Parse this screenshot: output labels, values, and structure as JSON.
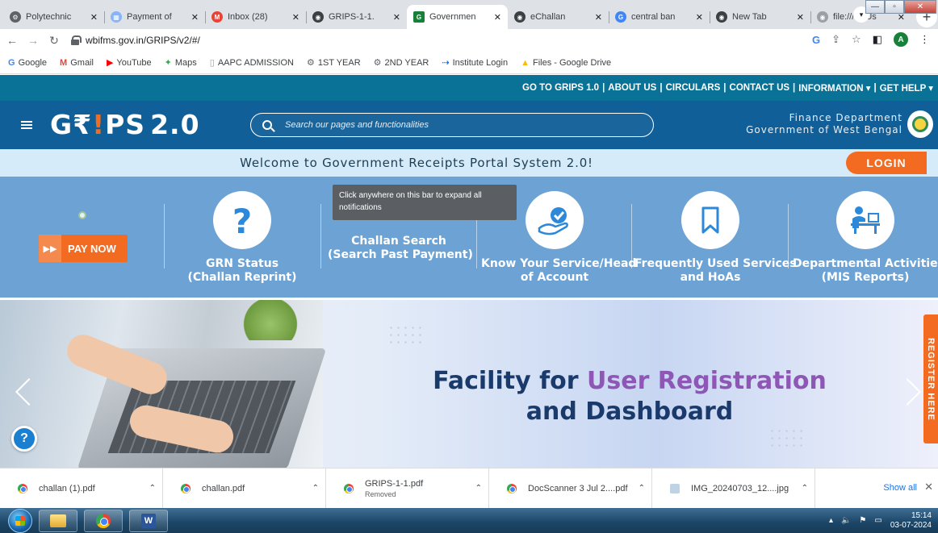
{
  "browser": {
    "tabs": [
      {
        "title": "Polytechnic",
        "favicon_color": "#5f6368",
        "active": false
      },
      {
        "title": "Payment of",
        "favicon_color": "#8ab4f8",
        "active": false
      },
      {
        "title": "Inbox (28)",
        "favicon_color": "#ea4335",
        "active": false
      },
      {
        "title": "GRIPS-1-1.",
        "favicon_color": "#3c4043",
        "active": false
      },
      {
        "title": "Governmen",
        "favicon_color": "#188038",
        "active": true
      },
      {
        "title": "eChallan",
        "favicon_color": "#3c4043",
        "active": false
      },
      {
        "title": "central ban",
        "favicon_color": "#4285f4",
        "active": false
      },
      {
        "title": "New Tab",
        "favicon_color": "#3c4043",
        "active": false
      },
      {
        "title": "file:///C:/Us",
        "favicon_color": "#9aa0a6",
        "active": false
      }
    ],
    "new_tab_label": "+",
    "url": "wbifms.gov.in/GRIPS/v2/#/",
    "profile_initial": "A",
    "bookmarks": [
      {
        "label": "Google",
        "icon": "G",
        "color": "#4285f4"
      },
      {
        "label": "Gmail",
        "icon": "M",
        "color": "#ea4335"
      },
      {
        "label": "YouTube",
        "icon": "▶",
        "color": "#ff0000"
      },
      {
        "label": "Maps",
        "icon": "✦",
        "color": "#34a853"
      },
      {
        "label": "AAPC ADMISSION",
        "icon": "▯",
        "color": "#9aa0a6"
      },
      {
        "label": "1ST YEAR",
        "icon": "⚙",
        "color": "#5f6368"
      },
      {
        "label": "2ND YEAR",
        "icon": "⚙",
        "color": "#5f6368"
      },
      {
        "label": "Institute Login",
        "icon": "⇢",
        "color": "#1a73e8"
      },
      {
        "label": "Files - Google Drive",
        "icon": "▲",
        "color": "#fbbc05"
      }
    ]
  },
  "site": {
    "topnav": [
      "GO TO GRIPS 1.0",
      "ABOUT US",
      "CIRCULARS",
      "CONTACT US",
      "INFORMATION ▾",
      "GET HELP ▾"
    ],
    "logo_prefix": "G₹",
    "logo_bang": "!",
    "logo_suffix": "PS",
    "logo_version": "2.0",
    "search_placeholder": "Search our pages and functionalities",
    "dept_line1": "Finance Department",
    "dept_line2": "Government of West Bengal",
    "welcome": "Welcome to Government Receipts Portal System 2.0!",
    "login": "LOGIN",
    "pay_now": "PAY NOW",
    "tooltip": "Click anywhere on this bar to expand all notifications",
    "tiles": [
      {
        "line1": "GRN Status",
        "line2": "(Challan Reprint)"
      },
      {
        "line1": "Challan Search",
        "line2": "(Search Past Payment)"
      },
      {
        "line1": "Know Your Service/Head",
        "line2": "of Account"
      },
      {
        "line1": "Frequently Used Services",
        "line2": "and HoAs"
      },
      {
        "line1": "Departmental Activities",
        "line2": "(MIS Reports)"
      }
    ],
    "banner_line1_a": "Facility for ",
    "banner_line1_b": "User Registration",
    "banner_line2": "and Dashboard",
    "register_here": "REGISTER HERE",
    "help": "?",
    "colors": {
      "accent_orange": "#f26b21",
      "header_blue": "#115f98",
      "tiles_blue": "#6ca2d4"
    }
  },
  "downloads": {
    "items": [
      {
        "name": "challan (1).pdf",
        "status": ""
      },
      {
        "name": "challan.pdf",
        "status": ""
      },
      {
        "name": "GRIPS-1-1.pdf",
        "status": "Removed"
      },
      {
        "name": "DocScanner 3 Jul 2....pdf",
        "status": ""
      },
      {
        "name": "IMG_20240703_12....jpg",
        "status": ""
      }
    ],
    "show_all": "Show all"
  },
  "taskbar": {
    "time": "15:14",
    "date": "03-07-2024"
  }
}
